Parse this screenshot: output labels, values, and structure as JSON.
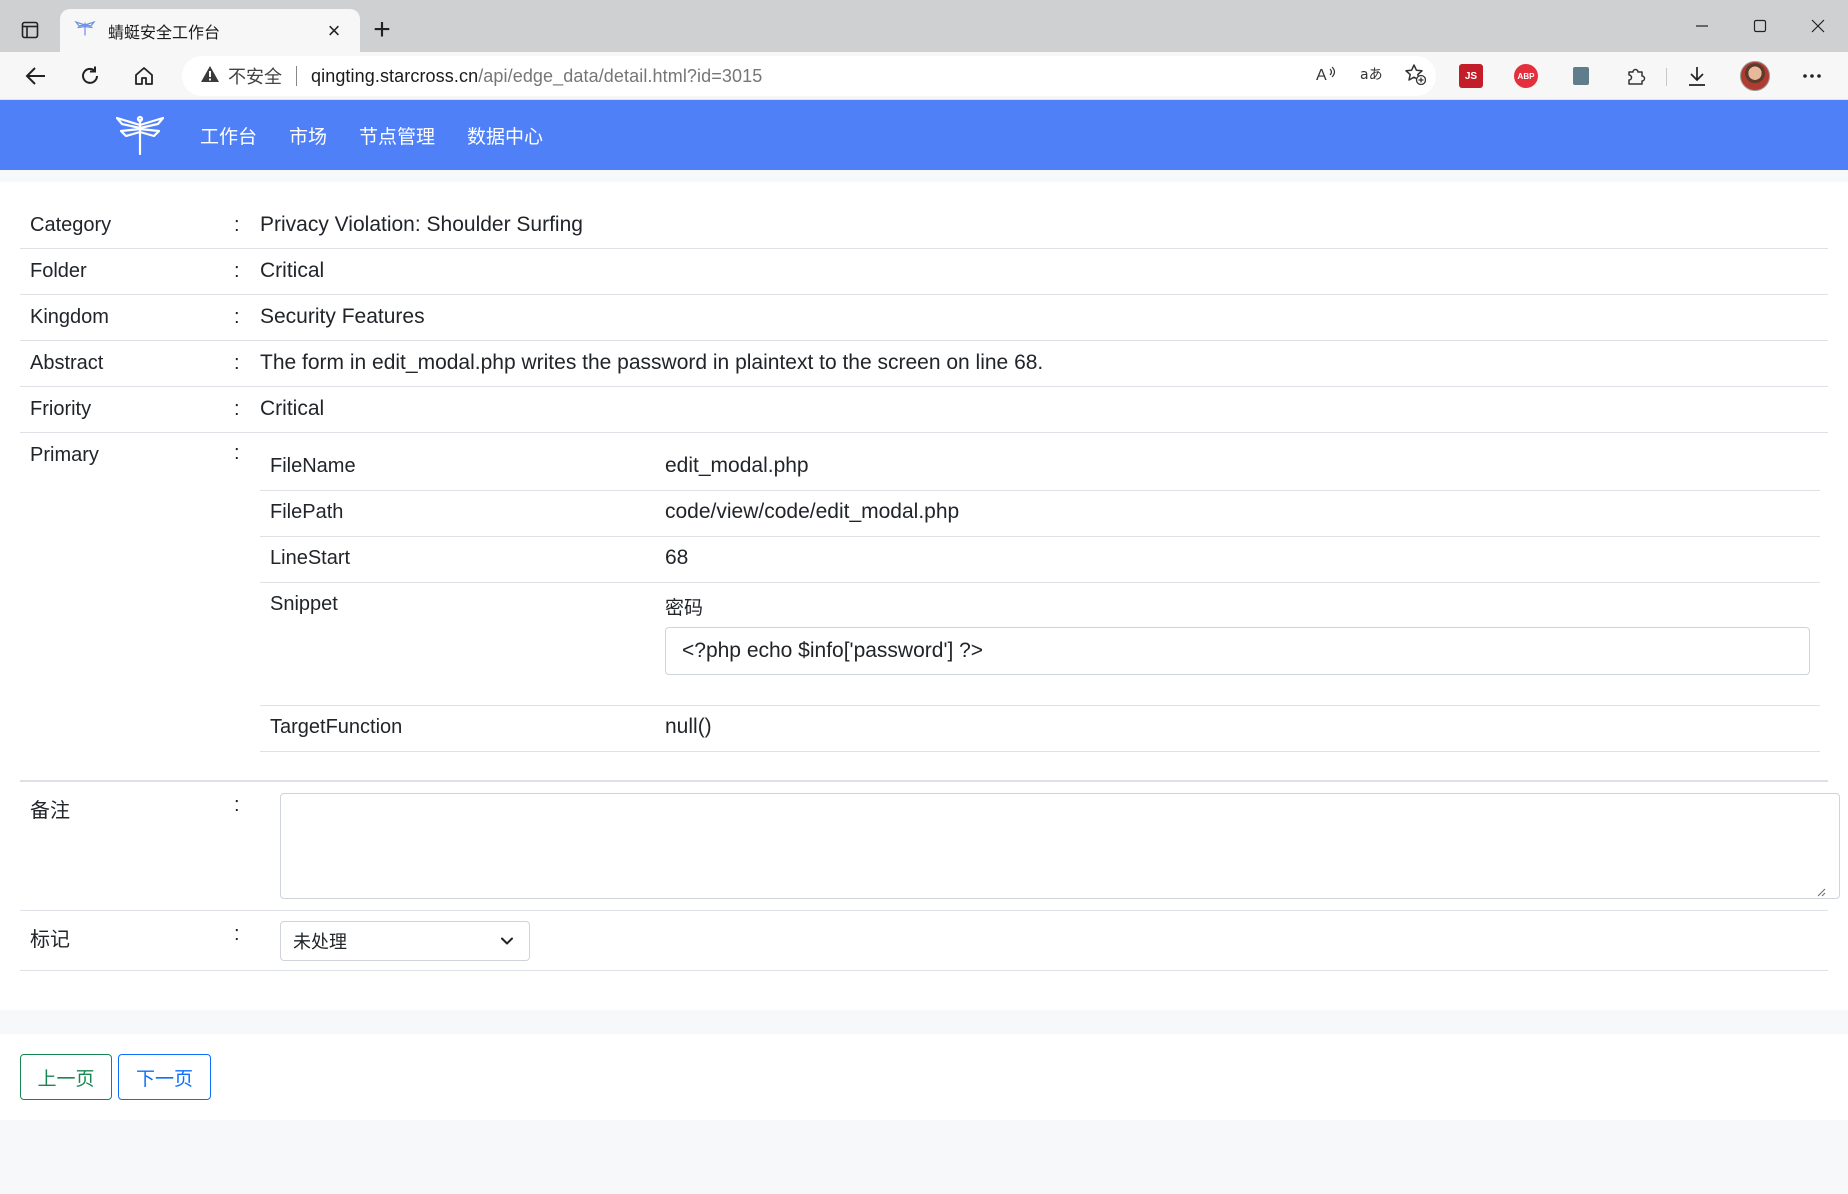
{
  "browser": {
    "tab_title": "蜻蜓安全工作台",
    "security_label": "不安全",
    "url_host": "qingting.starcross.cn",
    "url_path": "/api/edge_data/detail.html?id=3015",
    "extensions": [
      "JS",
      "ABP"
    ]
  },
  "site": {
    "nav": [
      "工作台",
      "市场",
      "节点管理",
      "数据中心"
    ],
    "header_color": "#4f80f8"
  },
  "detail": {
    "rows": [
      {
        "label": "Category",
        "value": "Privacy Violation: Shoulder Surfing"
      },
      {
        "label": "Folder",
        "value": "Critical"
      },
      {
        "label": "Kingdom",
        "value": "Security Features"
      },
      {
        "label": "Abstract",
        "value": "The form in edit_modal.php writes the password in plaintext to the screen on line 68."
      },
      {
        "label": "Friority",
        "value": "Critical"
      }
    ],
    "separator": ":",
    "primary": {
      "label": "Primary",
      "filename_key": "FileName",
      "filename": "edit_modal.php",
      "filepath_key": "FilePath",
      "filepath": "code/view/code/edit_modal.php",
      "linestart_key": "LineStart",
      "linestart": "68",
      "snippet_key": "Snippet",
      "snippet_caption": "密码",
      "snippet_code": "<?php echo $info['password'] ?>",
      "targetfunction_key": "TargetFunction",
      "targetfunction": "null()"
    },
    "notes": {
      "label": "备注",
      "value": ""
    },
    "mark": {
      "label": "标记",
      "selected": "未处理"
    }
  },
  "pager": {
    "prev": "上一页",
    "next": "下一页"
  }
}
